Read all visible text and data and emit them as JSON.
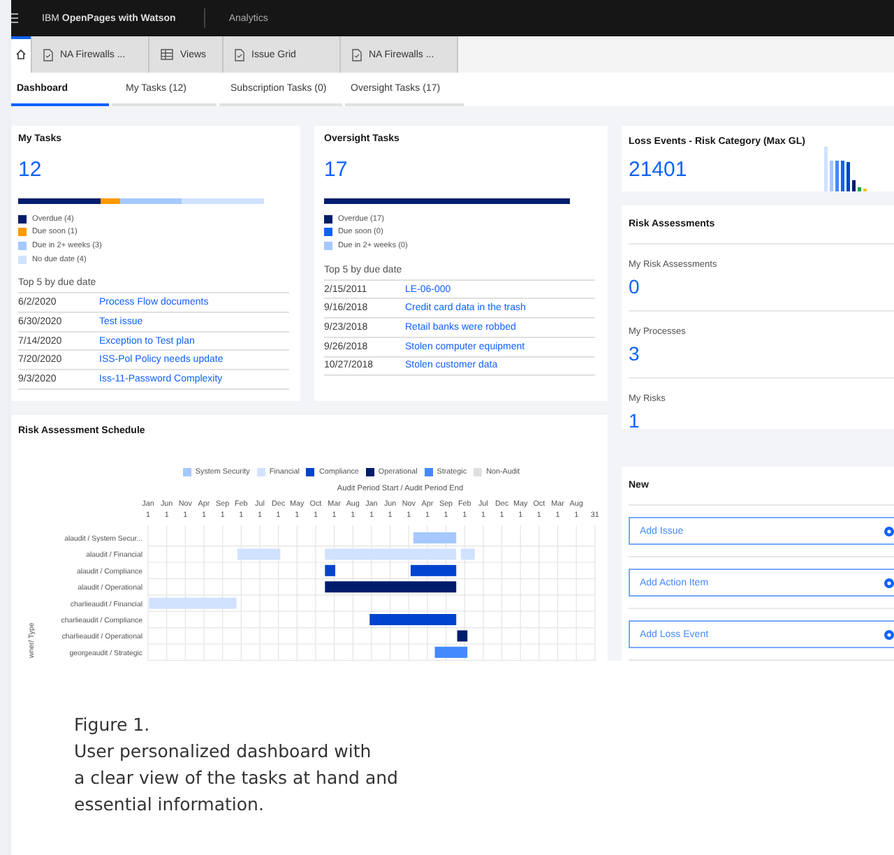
{
  "header": {
    "product": "IBM **OpenPages with Watson**",
    "section": "Analytics"
  },
  "doc_tabs": [
    {
      "kind": "home",
      "selected": true
    },
    {
      "kind": "document",
      "label": "NA Firewalls ...",
      "selected": false
    },
    {
      "kind": "table",
      "label": "Views",
      "selected": false
    },
    {
      "kind": "document",
      "label": "Issue Grid",
      "selected": false
    },
    {
      "kind": "document",
      "label": "NA Firewalls ...",
      "selected": false
    }
  ],
  "nav_tabs": [
    {
      "label": "Dashboard",
      "selected": true
    },
    {
      "label": "My Tasks (12)",
      "selected": false
    },
    {
      "label": "Subscription Tasks (0)",
      "selected": false
    },
    {
      "label": "Oversight Tasks (17)",
      "selected": false
    }
  ],
  "task_cards": [
    {
      "title": "My Tasks",
      "count": "12",
      "legend": [
        {
          "label": "Overdue (4)",
          "color": "#001d6c"
        },
        {
          "label": "Due soon (1)",
          "color": "#ff9a00"
        },
        {
          "label": "Due in 2+ weeks (3)",
          "color": "#a6c8ff"
        },
        {
          "label": "No due date (4)",
          "color": "#d0e2ff"
        }
      ],
      "list_title": "Top 5 by due date",
      "rows": [
        {
          "date": "6/2/2020",
          "link": "Process Flow documents"
        },
        {
          "date": "6/30/2020",
          "link": "Test issue"
        },
        {
          "date": "7/14/2020",
          "link": "Exception to Test plan"
        },
        {
          "date": "7/20/2020",
          "link": "ISS-Pol Policy needs update"
        },
        {
          "date": "9/3/2020",
          "link": "Iss-11-Password Complexity"
        }
      ]
    },
    {
      "title": "Oversight Tasks",
      "count": "17",
      "legend": [
        {
          "label": "Overdue (17)",
          "color": "#001d6c"
        },
        {
          "label": "Due soon (0)",
          "color": "#0f62fe"
        },
        {
          "label": "Due in 2+ weeks (0)",
          "color": "#a6c8ff"
        }
      ],
      "list_title": "Top 5 by due date",
      "rows": [
        {
          "date": "2/15/2011",
          "link": "LE-06-000"
        },
        {
          "date": "9/16/2018",
          "link": "Credit card data in the trash"
        },
        {
          "date": "9/23/2018",
          "link": "Retail banks were robbed"
        },
        {
          "date": "9/26/2018",
          "link": "Stolen computer equipment"
        },
        {
          "date": "10/27/2018",
          "link": "Stolen customer data"
        }
      ]
    }
  ],
  "schedule": {
    "title": "Risk Assessment Schedule",
    "legend": [
      {
        "name": "System Security",
        "color": "#a6c8ff"
      },
      {
        "name": "Financial",
        "color": "#d0e2ff"
      },
      {
        "name": "Compliance",
        "color": "#0043ce"
      },
      {
        "name": "Operational",
        "color": "#001d6c"
      },
      {
        "name": "Strategic",
        "color": "#4589ff"
      },
      {
        "name": "Non-Audit",
        "color": "#e0e0e0"
      }
    ],
    "axis_title": "Audit Period Start / Audit Period End",
    "ticks": [
      {
        "month": "Jan",
        "day": "1"
      },
      {
        "month": "Jun",
        "day": "1"
      },
      {
        "month": "Nov",
        "day": "1"
      },
      {
        "month": "Apr",
        "day": "1"
      },
      {
        "month": "Sep",
        "day": "1"
      },
      {
        "month": "Feb",
        "day": "1"
      },
      {
        "month": "Jul",
        "day": "1"
      },
      {
        "month": "Dec",
        "day": "1"
      },
      {
        "month": "May",
        "day": "1"
      },
      {
        "month": "Oct",
        "day": "1"
      },
      {
        "month": "Mar",
        "day": "1"
      },
      {
        "month": "Aug",
        "day": "1"
      },
      {
        "month": "Jan",
        "day": "1"
      },
      {
        "month": "Jun",
        "day": "1"
      },
      {
        "month": "Nov",
        "day": "1"
      },
      {
        "month": "Apr",
        "day": "1"
      },
      {
        "month": "Sep",
        "day": "1"
      },
      {
        "month": "Feb",
        "day": "1"
      },
      {
        "month": "Jul",
        "day": "1"
      },
      {
        "month": "Dec",
        "day": "1"
      },
      {
        "month": "May",
        "day": "1"
      },
      {
        "month": "Oct",
        "day": "1"
      },
      {
        "month": "Mar",
        "day": "1"
      },
      {
        "month": "Aug",
        "day": "1"
      },
      {
        "day": "31"
      }
    ],
    "rows": [
      "alaudit / System Secur...",
      "alaudit / Financial",
      "alaudit / Compliance",
      "alaudit / Operational",
      "charlieaudit / Financial",
      "charlieaudit / Compliance",
      "charlieaudit / Operational",
      "georgeaudit / Strategic"
    ],
    "y_axis_label": "wner/ Type"
  },
  "loss_events": {
    "title": "Loss Events - Risk Category (Max GL)",
    "count": "21401"
  },
  "risk_assessments": {
    "title": "Risk Assessments",
    "items": [
      {
        "label": "My Risk Assessments",
        "value": "0"
      },
      {
        "label": "My Processes",
        "value": "3"
      },
      {
        "label": "My Risks",
        "value": "1"
      }
    ]
  },
  "new_panel": {
    "title": "New",
    "buttons": [
      "Add Issue",
      "Add Action Item",
      "Add Loss Event"
    ]
  },
  "caption": {
    "title": "Figure 1.",
    "lines": [
      "User personalized dashboard with",
      "a clear view of the tasks at hand and",
      "essential information."
    ]
  }
}
